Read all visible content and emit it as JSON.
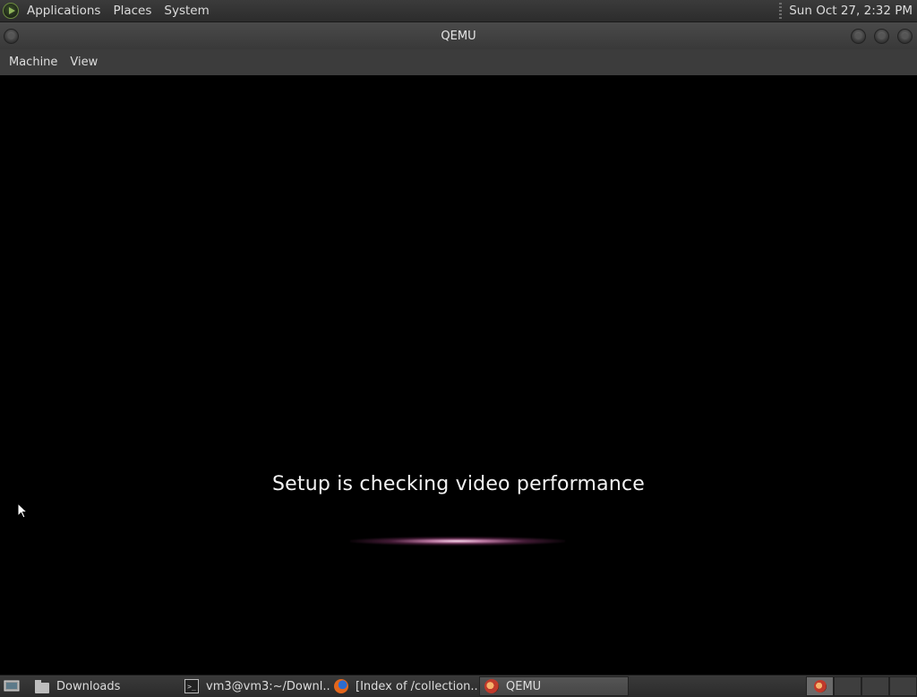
{
  "top_panel": {
    "menus": [
      "Applications",
      "Places",
      "System"
    ],
    "clock": "Sun Oct 27,  2:32 PM"
  },
  "window": {
    "title": "QEMU",
    "menus": [
      "Machine",
      "View"
    ]
  },
  "vm": {
    "message": "Setup is checking video performance"
  },
  "taskbar": {
    "tasks": [
      {
        "label": "Downloads",
        "icon": "folder-icon"
      },
      {
        "label": "vm3@vm3:~/Downl...",
        "icon": "terminal-icon"
      },
      {
        "label": "[Index of /collection...",
        "icon": "firefox-icon"
      },
      {
        "label": "QEMU",
        "icon": "qemu-icon",
        "active": true
      }
    ]
  }
}
